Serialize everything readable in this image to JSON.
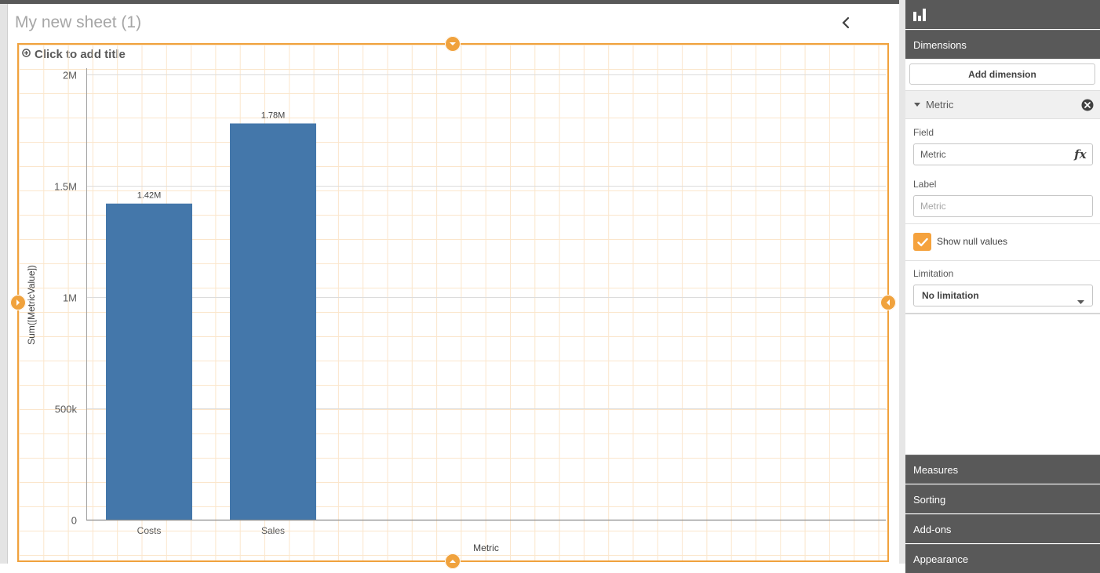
{
  "sheet": {
    "title": "My new sheet (1)"
  },
  "object": {
    "add_title_label": "Click to add title"
  },
  "colors": {
    "accent_orange": "#f0a23d",
    "bar_blue": "#4477aa",
    "panel_dark": "#595959"
  },
  "icons": {
    "collapse": "chevron-left-icon",
    "chart_type": "bar-chart-icon",
    "add_title": "plus-circle-icon",
    "remove_dimension": "close-circle-icon",
    "expression": "fx-icon",
    "checkbox": "check-icon",
    "select": "caret-down-icon"
  },
  "chart_data": {
    "type": "bar",
    "categories": [
      "Costs",
      "Sales"
    ],
    "values": [
      1420000,
      1780000
    ],
    "value_labels": [
      "1.42M",
      "1.78M"
    ],
    "xlabel": "Metric",
    "ylabel": "Sum([MetricValue])",
    "ylim": [
      0,
      2000000
    ],
    "yticks": [
      0,
      500000,
      1000000,
      1500000,
      2000000
    ],
    "ytick_labels": [
      "0",
      "500k",
      "1M",
      "1.5M",
      "2M"
    ],
    "grid": true
  },
  "panel": {
    "sections": {
      "dimensions": "Dimensions",
      "measures": "Measures",
      "sorting": "Sorting",
      "addons": "Add-ons",
      "appearance": "Appearance"
    },
    "add_dimension_label": "Add dimension",
    "dimension_item": {
      "name": "Metric",
      "field_label": "Field",
      "field_value": "Metric",
      "fx_label": "fx",
      "label_label": "Label",
      "label_placeholder": "Metric",
      "show_null_label": "Show null values",
      "show_null_checked": true,
      "limitation_label": "Limitation",
      "limitation_value": "No limitation"
    }
  }
}
